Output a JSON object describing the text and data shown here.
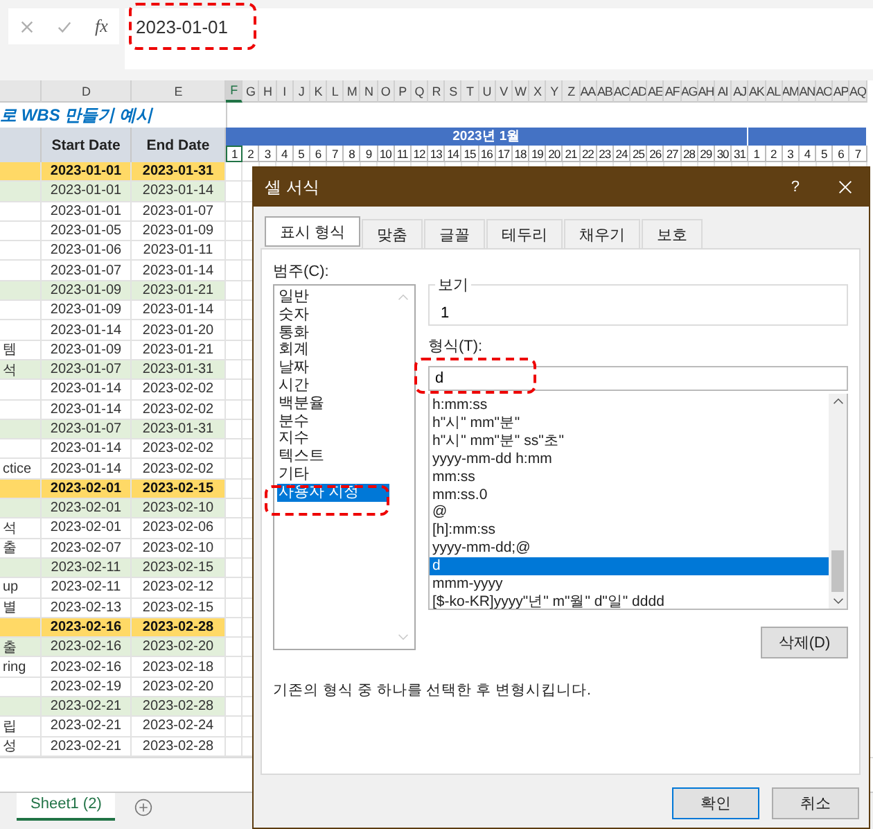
{
  "formula_bar": {
    "function_label": "fx",
    "value": "2023-01-01"
  },
  "columns": [
    {
      "letter": "D",
      "selected": false
    },
    {
      "letter": "E",
      "selected": false
    },
    {
      "letter": "F",
      "selected": true
    },
    {
      "letter": "G",
      "selected": false
    },
    {
      "letter": "H",
      "selected": false
    },
    {
      "letter": "I",
      "selected": false
    },
    {
      "letter": "J",
      "selected": false
    },
    {
      "letter": "K",
      "selected": false
    },
    {
      "letter": "L",
      "selected": false
    },
    {
      "letter": "M",
      "selected": false
    },
    {
      "letter": "N",
      "selected": false
    },
    {
      "letter": "O",
      "selected": false
    },
    {
      "letter": "P",
      "selected": false
    },
    {
      "letter": "Q",
      "selected": false
    },
    {
      "letter": "R",
      "selected": false
    },
    {
      "letter": "S",
      "selected": false
    },
    {
      "letter": "T",
      "selected": false
    },
    {
      "letter": "U",
      "selected": false
    },
    {
      "letter": "V",
      "selected": false
    },
    {
      "letter": "W",
      "selected": false
    },
    {
      "letter": "X",
      "selected": false
    },
    {
      "letter": "Y",
      "selected": false
    },
    {
      "letter": "Z",
      "selected": false
    },
    {
      "letter": "AA",
      "selected": false
    },
    {
      "letter": "AB",
      "selected": false
    },
    {
      "letter": "AC",
      "selected": false
    },
    {
      "letter": "AD",
      "selected": false
    },
    {
      "letter": "AE",
      "selected": false
    },
    {
      "letter": "AF",
      "selected": false
    },
    {
      "letter": "AG",
      "selected": false
    },
    {
      "letter": "AH",
      "selected": false
    },
    {
      "letter": "AI",
      "selected": false
    },
    {
      "letter": "AJ",
      "selected": false
    },
    {
      "letter": "AK",
      "selected": false
    },
    {
      "letter": "AL",
      "selected": false
    },
    {
      "letter": "AM",
      "selected": false
    },
    {
      "letter": "AN",
      "selected": false
    },
    {
      "letter": "AO",
      "selected": false
    },
    {
      "letter": "AP",
      "selected": false
    },
    {
      "letter": "AQ",
      "selected": false
    }
  ],
  "sheet": {
    "title": "로 WBS 만들기 예시",
    "start_header": "Start Date",
    "end_header": "End Date",
    "months": [
      {
        "label": "2023년 1월",
        "days": [
          {
            "day": "1",
            "selected": true
          },
          {
            "day": "2",
            "selected": false
          },
          {
            "day": "3",
            "selected": false
          },
          {
            "day": "4",
            "selected": false
          },
          {
            "day": "5",
            "selected": false
          },
          {
            "day": "6",
            "selected": false
          },
          {
            "day": "7",
            "selected": false
          },
          {
            "day": "8",
            "selected": false
          },
          {
            "day": "9",
            "selected": false
          },
          {
            "day": "10",
            "selected": false
          },
          {
            "day": "11",
            "selected": false
          },
          {
            "day": "12",
            "selected": false
          },
          {
            "day": "13",
            "selected": false
          },
          {
            "day": "14",
            "selected": false
          },
          {
            "day": "15",
            "selected": false
          },
          {
            "day": "16",
            "selected": false
          },
          {
            "day": "17",
            "selected": false
          },
          {
            "day": "18",
            "selected": false
          },
          {
            "day": "19",
            "selected": false
          },
          {
            "day": "20",
            "selected": false
          },
          {
            "day": "21",
            "selected": false
          },
          {
            "day": "22",
            "selected": false
          },
          {
            "day": "23",
            "selected": false
          },
          {
            "day": "24",
            "selected": false
          },
          {
            "day": "25",
            "selected": false
          },
          {
            "day": "26",
            "selected": false
          },
          {
            "day": "27",
            "selected": false
          },
          {
            "day": "28",
            "selected": false
          },
          {
            "day": "29",
            "selected": false
          },
          {
            "day": "30",
            "selected": false
          },
          {
            "day": "31",
            "selected": false
          }
        ]
      },
      {
        "days": [
          {
            "day": "1",
            "selected": false
          },
          {
            "day": "2",
            "selected": false
          },
          {
            "day": "3",
            "selected": false
          },
          {
            "day": "4",
            "selected": false
          },
          {
            "day": "5",
            "selected": false
          },
          {
            "day": "6",
            "selected": false
          },
          {
            "day": "7",
            "selected": false
          }
        ]
      }
    ],
    "rows": [
      {
        "kind": "phase",
        "start": "2023-01-01",
        "end": "2023-01-31"
      },
      {
        "kind": "group",
        "start": "2023-01-01",
        "end": "2023-01-14"
      },
      {
        "kind": "task",
        "start": "2023-01-01",
        "end": "2023-01-07"
      },
      {
        "kind": "task",
        "start": "2023-01-05",
        "end": "2023-01-09"
      },
      {
        "kind": "task",
        "start": "2023-01-06",
        "end": "2023-01-11"
      },
      {
        "kind": "task",
        "start": "2023-01-07",
        "end": "2023-01-14"
      },
      {
        "kind": "group",
        "start": "2023-01-09",
        "end": "2023-01-21"
      },
      {
        "kind": "task",
        "start": "2023-01-09",
        "end": "2023-01-14"
      },
      {
        "kind": "task",
        "start": "2023-01-14",
        "end": "2023-01-20"
      },
      {
        "kind": "task",
        "label": "템",
        "start": "2023-01-09",
        "end": "2023-01-21"
      },
      {
        "kind": "group",
        "label": "석",
        "start": "2023-01-07",
        "end": "2023-01-31"
      },
      {
        "kind": "task",
        "start": "2023-01-14",
        "end": "2023-02-02"
      },
      {
        "kind": "task",
        "start": "2023-01-14",
        "end": "2023-02-02"
      },
      {
        "kind": "group",
        "start": "2023-01-07",
        "end": "2023-01-31"
      },
      {
        "kind": "task",
        "start": "2023-01-14",
        "end": "2023-02-02"
      },
      {
        "kind": "task",
        "label": "ctice",
        "start": "2023-01-14",
        "end": "2023-02-02"
      },
      {
        "kind": "phase",
        "start": "2023-02-01",
        "end": "2023-02-15"
      },
      {
        "kind": "group",
        "start": "2023-02-01",
        "end": "2023-02-10"
      },
      {
        "kind": "task",
        "label": "석",
        "start": "2023-02-01",
        "end": "2023-02-06"
      },
      {
        "kind": "task",
        "label": "출",
        "start": "2023-02-07",
        "end": "2023-02-10"
      },
      {
        "kind": "group",
        "start": "2023-02-11",
        "end": "2023-02-15"
      },
      {
        "kind": "task",
        "label": "up",
        "start": "2023-02-11",
        "end": "2023-02-12"
      },
      {
        "kind": "task",
        "label": "별",
        "start": "2023-02-13",
        "end": "2023-02-15"
      },
      {
        "kind": "phase",
        "start": "2023-02-16",
        "end": "2023-02-28"
      },
      {
        "kind": "group",
        "label": "출",
        "start": "2023-02-16",
        "end": "2023-02-20"
      },
      {
        "kind": "task",
        "label": "ring",
        "start": "2023-02-16",
        "end": "2023-02-18"
      },
      {
        "kind": "task",
        "start": "2023-02-19",
        "end": "2023-02-20"
      },
      {
        "kind": "group",
        "start": "2023-02-21",
        "end": "2023-02-28"
      },
      {
        "kind": "task",
        "label": "립",
        "start": "2023-02-21",
        "end": "2023-02-24"
      },
      {
        "kind": "task",
        "label": "성",
        "start": "2023-02-21",
        "end": "2023-02-28"
      }
    ]
  },
  "sheet_tabs": [
    {
      "label": "Sheet1 (2)",
      "selected": true
    }
  ],
  "dialog": {
    "title": "셀 서식",
    "help": "?",
    "tabs": [
      {
        "label": "표시 형식",
        "selected": true
      },
      {
        "label": "맞춤",
        "selected": false
      },
      {
        "label": "글꼴",
        "selected": false
      },
      {
        "label": "테두리",
        "selected": false
      },
      {
        "label": "채우기",
        "selected": false
      },
      {
        "label": "보호",
        "selected": false
      }
    ],
    "category_label": "범주(C):",
    "categories": [
      {
        "label": "일반",
        "selected": false
      },
      {
        "label": "숫자",
        "selected": false
      },
      {
        "label": "통화",
        "selected": false
      },
      {
        "label": "회계",
        "selected": false
      },
      {
        "label": "날짜",
        "selected": false
      },
      {
        "label": "시간",
        "selected": false
      },
      {
        "label": "백분율",
        "selected": false
      },
      {
        "label": "분수",
        "selected": false
      },
      {
        "label": "지수",
        "selected": false
      },
      {
        "label": "텍스트",
        "selected": false
      },
      {
        "label": "기타",
        "selected": false
      },
      {
        "label": "사용자 지정",
        "selected": true
      }
    ],
    "preview_label": "보기",
    "preview_value": "1",
    "format_label": "형식(T):",
    "format_value": "d",
    "formats": [
      {
        "label": "h:mm:ss",
        "selected": false
      },
      {
        "label": "h\"시\" mm\"분\"",
        "selected": false
      },
      {
        "label": "h\"시\" mm\"분\" ss\"초\"",
        "selected": false
      },
      {
        "label": "yyyy-mm-dd h:mm",
        "selected": false
      },
      {
        "label": "mm:ss",
        "selected": false
      },
      {
        "label": "mm:ss.0",
        "selected": false
      },
      {
        "label": "@",
        "selected": false
      },
      {
        "label": "[h]:mm:ss",
        "selected": false
      },
      {
        "label": "yyyy-mm-dd;@",
        "selected": false
      },
      {
        "label": "d",
        "selected": true
      },
      {
        "label": "mmm-yyyy",
        "selected": false
      },
      {
        "label": "[$-ko-KR]yyyy\"년\" m\"월\" d\"일\" dddd",
        "selected": false
      }
    ],
    "delete_button": "삭제(D)",
    "description": "기존의 형식 중 하나를 선택한 후 변형시킵니다.",
    "buttons": [
      {
        "label": "확인",
        "kind": "primary"
      },
      {
        "label": "취소",
        "kind": "secondary"
      }
    ]
  }
}
